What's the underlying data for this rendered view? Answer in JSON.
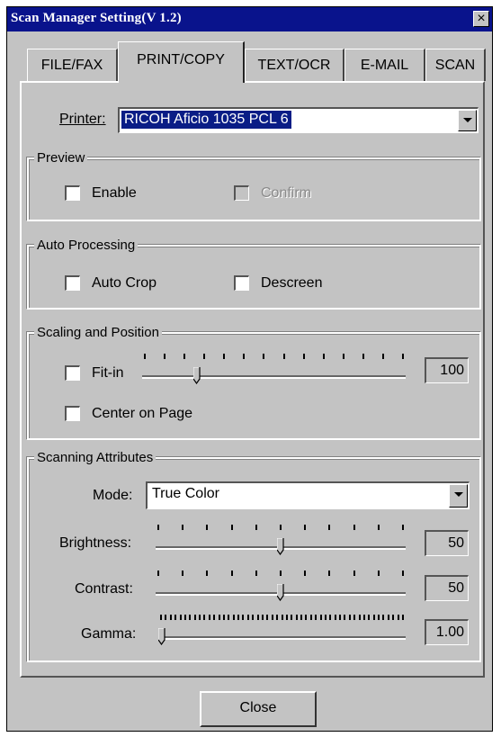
{
  "window": {
    "title": "Scan Manager Setting(V 1.2)",
    "close_glyph": "×"
  },
  "tabs": [
    {
      "label": "FILE/FAX",
      "active": false
    },
    {
      "label": "PRINT/COPY",
      "active": true
    },
    {
      "label": "TEXT/OCR",
      "active": false
    },
    {
      "label": "E-MAIL",
      "active": false
    },
    {
      "label": "SCAN",
      "active": false
    }
  ],
  "printer": {
    "label": "Printer:",
    "value": "RICOH Aficio 1035 PCL 6"
  },
  "preview": {
    "title": "Preview",
    "enable": {
      "label": "Enable",
      "checked": false
    },
    "confirm": {
      "label": "Confirm",
      "checked": false,
      "disabled": true
    }
  },
  "auto_processing": {
    "title": "Auto Processing",
    "auto_crop": {
      "label": "Auto Crop",
      "checked": false
    },
    "descreen": {
      "label": "Descreen",
      "checked": false
    }
  },
  "scaling": {
    "title": "Scaling and Position",
    "fit_in": {
      "label": "Fit-in",
      "checked": false,
      "value": "100",
      "position": 0.2
    },
    "center_on_page": {
      "label": "Center on Page",
      "checked": false
    }
  },
  "scanning": {
    "title": "Scanning Attributes",
    "mode": {
      "label": "Mode:",
      "value": "True Color"
    },
    "brightness": {
      "label": "Brightness:",
      "value": "50",
      "position": 0.5
    },
    "contrast": {
      "label": "Contrast:",
      "value": "50",
      "position": 0.5
    },
    "gamma": {
      "label": "Gamma:",
      "value": "1.00",
      "position": 0.0
    }
  },
  "footer": {
    "close_label": "Close"
  }
}
